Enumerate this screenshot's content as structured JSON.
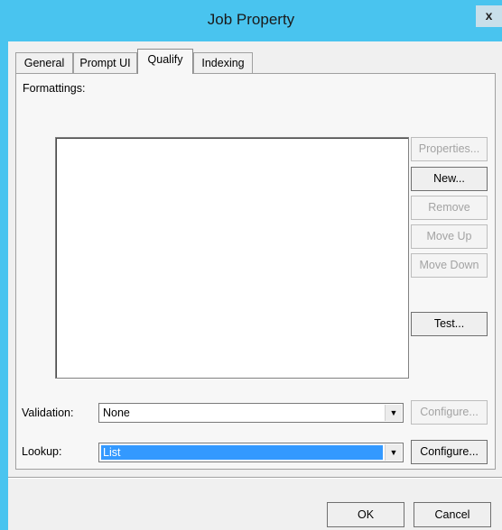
{
  "window": {
    "title": "Job Property",
    "close_label": "x"
  },
  "tabs": [
    {
      "label": "General",
      "active": false
    },
    {
      "label": "Prompt UI",
      "active": false
    },
    {
      "label": "Qualify",
      "active": true
    },
    {
      "label": "Indexing",
      "active": false
    }
  ],
  "formattings": {
    "label": "Formattings:",
    "items": [],
    "buttons": {
      "properties": "Properties...",
      "new": "New...",
      "remove": "Remove",
      "move_up": "Move Up",
      "move_down": "Move Down",
      "test": "Test..."
    }
  },
  "validation": {
    "label": "Validation:",
    "value": "None",
    "configure": "Configure..."
  },
  "lookup": {
    "label": "Lookup:",
    "value": "List",
    "configure": "Configure..."
  },
  "footer": {
    "ok": "OK",
    "cancel": "Cancel"
  },
  "icons": {
    "combo_arrow": "dropdown-arrow-icon"
  },
  "colors": {
    "title_bar": "#49c4ef",
    "selection": "#3399ff"
  }
}
